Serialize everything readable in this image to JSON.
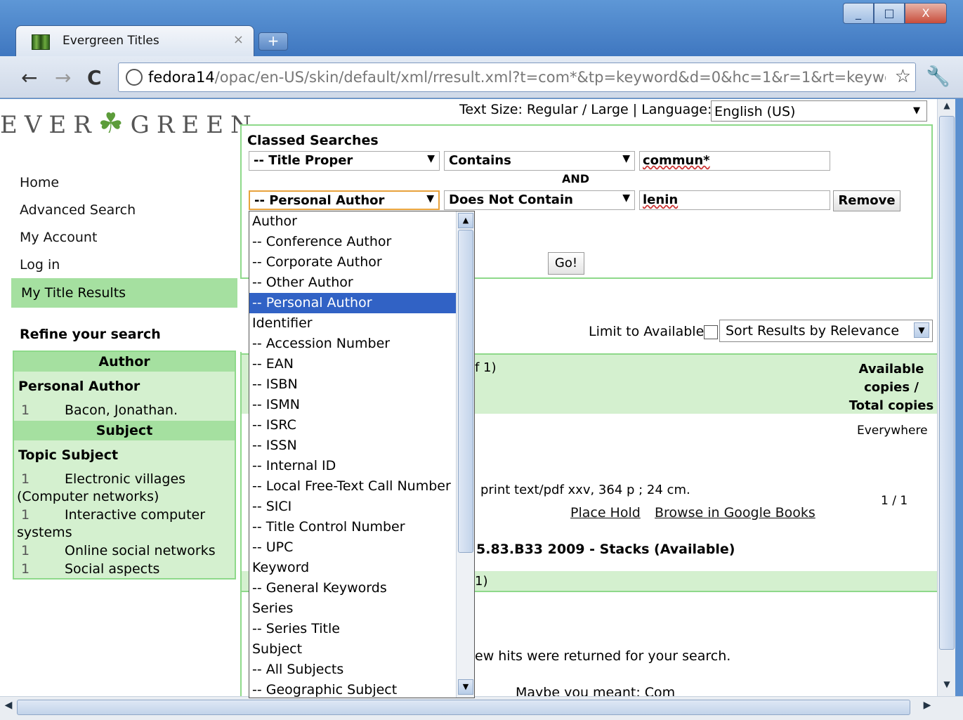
{
  "browser": {
    "tab_title": "Evergreen Titles",
    "tab_close": "×",
    "new_tab": "+",
    "url_host": "fedora14",
    "url_rest": "/opac/en-US/skin/default/xml/rresult.xml?t=com*&tp=keyword&d=0&hc=1&r=1&rt=keywc",
    "win_min": "_",
    "win_max": "□",
    "win_close": "X",
    "back": "←",
    "forward": "→",
    "reload": "C",
    "star": "☆",
    "wrench": "🔧"
  },
  "logo": {
    "left": "EVER",
    "leaf": "☘",
    "right": "GREEN"
  },
  "nav": {
    "home": "Home",
    "advanced": "Advanced Search",
    "account": "My Account",
    "login": "Log in",
    "results": "My Title Results"
  },
  "refine": {
    "title": "Refine your search",
    "author_head": "Author",
    "personal_author": "Personal Author",
    "authors": [
      {
        "count": "1",
        "name": "Bacon, Jonathan."
      }
    ],
    "subject_head": "Subject",
    "topic_subject": "Topic Subject",
    "subjects": [
      {
        "count": "1",
        "name": "Electronic villages",
        "cont": "(Computer networks)"
      },
      {
        "count": "1",
        "name": "Interactive computer",
        "cont": "systems"
      },
      {
        "count": "1",
        "name": "Online social networks",
        "cont": ""
      },
      {
        "count": "1",
        "name": "Social aspects",
        "cont": ""
      }
    ]
  },
  "top": {
    "text_size": "Text Size: Regular / Large | Language:",
    "language": "English (US)"
  },
  "classed": {
    "title": "Classed Searches",
    "row1": {
      "field": "-- Title Proper",
      "op": "Contains",
      "value": "commun*"
    },
    "and": "AND",
    "row2": {
      "field": "-- Personal Author",
      "op": "Does Not Contain",
      "value": "lenin"
    },
    "remove": "Remove",
    "go": "Go!"
  },
  "controls": {
    "limit": "Limit to Available",
    "sort": "Sort Results by Relevance"
  },
  "results": {
    "count_fragment": "f 1)",
    "available_head": "Available copies / Total copies",
    "everywhere": "Everywhere",
    "desc": "print text/pdf xxv, 364 p ; 24 cm.",
    "place_hold": "Place Hold",
    "google_books": "Browse in Google Books",
    "copies": "1 / 1",
    "call_number": "5.83.B33 2009 - Stacks (Available)",
    "foot_fragment": "1)",
    "few_hits": "ew hits were returned for your search.",
    "maybe": "Maybe you meant: Com"
  },
  "dropdown": {
    "options": [
      "Author",
      "-- Conference Author",
      "-- Corporate Author",
      "-- Other Author",
      "-- Personal Author",
      "Identifier",
      "-- Accession Number",
      "-- EAN",
      "-- ISBN",
      "-- ISMN",
      "-- ISRC",
      "-- ISSN",
      "-- Internal ID",
      "-- Local Free-Text Call Number",
      "-- SICI",
      "-- Title Control Number",
      "-- UPC",
      "Keyword",
      "-- General Keywords",
      "Series",
      "-- Series Title",
      "Subject",
      "-- All Subjects",
      "-- Geographic Subject"
    ],
    "selected": "-- Personal Author"
  }
}
